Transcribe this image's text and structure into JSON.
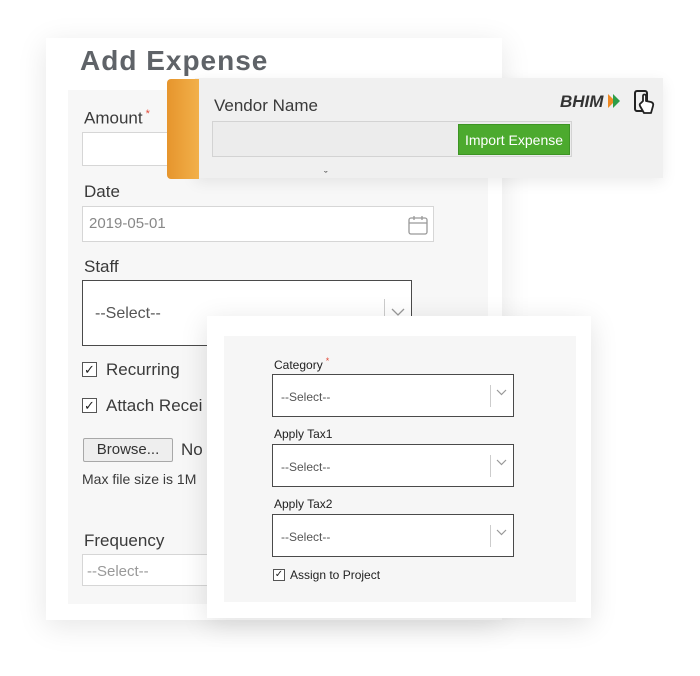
{
  "add_expense": {
    "title": "Add Expense",
    "amount_label": "Amount",
    "date_label": "Date",
    "date_value": "2019-05-01",
    "staff_label": "Staff",
    "staff_select": "--Select--",
    "recurring_label": "Recurring",
    "attach_label": "Attach Recei",
    "browse_label": "Browse...",
    "no_file_text": "No",
    "max_size_text": "Max file size is 1M",
    "frequency_label": "Frequency",
    "frequency_select": "--Select--"
  },
  "vendor": {
    "label": "Vendor Name",
    "import_button": "Import Expense",
    "bhim_logo": "BHIM",
    "icons": [
      "bhim-arrow-icon",
      "phone-tap-icon",
      "caret-down-icon"
    ]
  },
  "category_card": {
    "category_label": "Category",
    "category_select": "--Select--",
    "tax1_label": "Apply Tax1",
    "tax1_select": "--Select--",
    "tax2_label": "Apply Tax2",
    "tax2_select": "--Select--",
    "assign_label": "Assign to Project"
  },
  "colors": {
    "accent_orange": "#f2a33a",
    "import_green": "#4caa2e",
    "required_red": "#e24b3a",
    "title_gray": "#5f6368"
  }
}
